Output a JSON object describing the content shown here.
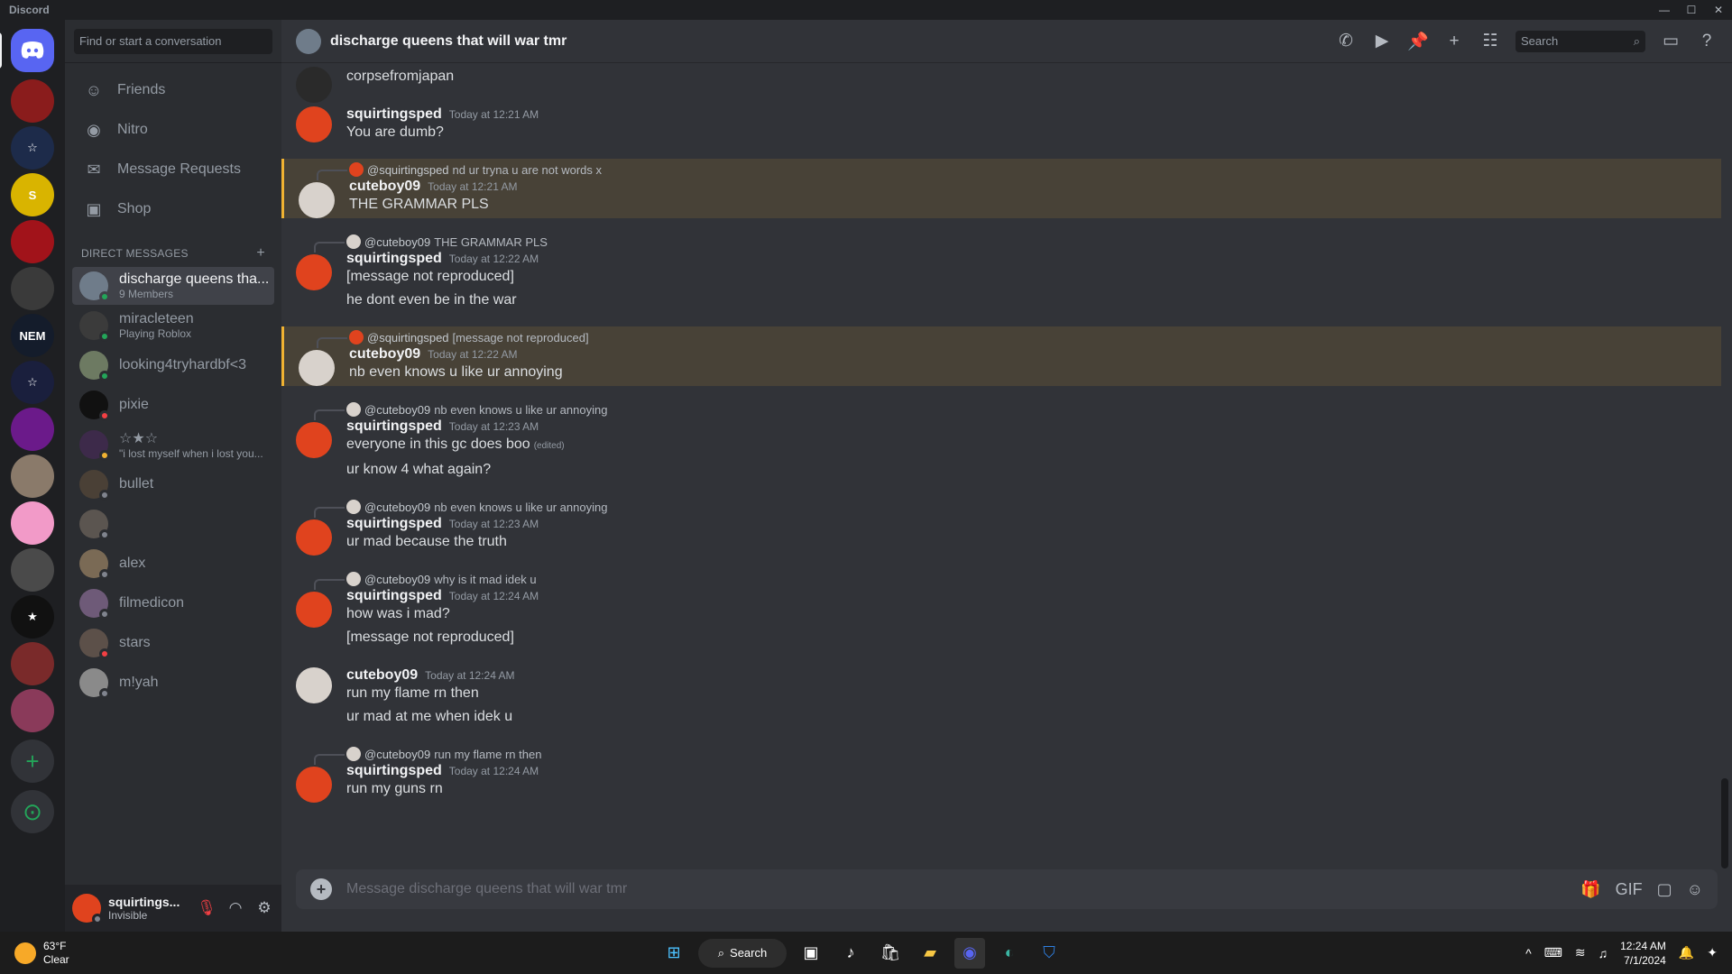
{
  "window": {
    "app_name": "Discord"
  },
  "dm_sidebar": {
    "search_placeholder": "Find or start a conversation",
    "nav": [
      {
        "label": "Friends"
      },
      {
        "label": "Nitro"
      },
      {
        "label": "Message Requests"
      },
      {
        "label": "Shop"
      }
    ],
    "section_title": "Direct Messages",
    "dms": [
      {
        "name": "discharge queens tha...",
        "sub": "9 Members",
        "status": "#23a559",
        "color": "#6f7c8a"
      },
      {
        "name": "miracleteen",
        "sub": "Playing Roblox",
        "status": "#23a559",
        "color": "#3b3b3b"
      },
      {
        "name": "looking4tryhardbf<3",
        "sub": "",
        "status": "#23a559",
        "color": "#6d7a62"
      },
      {
        "name": "pixie",
        "sub": "",
        "status": "#f23f43",
        "color": "#111111"
      },
      {
        "name": "☆★☆",
        "sub": "\"i lost myself when i lost you...",
        "status": "#f0b232",
        "color": "#3d2a4a"
      },
      {
        "name": "bullet",
        "sub": "",
        "status": "#80848e",
        "color": "#4a4036"
      },
      {
        "name": "",
        "sub": "",
        "status": "#80848e",
        "color": "#5b5550"
      },
      {
        "name": "alex",
        "sub": "",
        "status": "#80848e",
        "color": "#7a6a55"
      },
      {
        "name": "filmedicon",
        "sub": "",
        "status": "#80848e",
        "color": "#6e5a78"
      },
      {
        "name": "stars",
        "sub": "",
        "status": "#f23f43",
        "color": "#5c5049"
      },
      {
        "name": "m!yah",
        "sub": "",
        "status": "#80848e",
        "color": "#8a8a8a"
      }
    ]
  },
  "user_panel": {
    "name": "squirtings...",
    "status": "Invisible"
  },
  "channel": {
    "title": "discharge queens that will war tmr",
    "search_placeholder": "Search",
    "composer_placeholder": "Message discharge queens that will war tmr"
  },
  "messages": [
    {
      "author": "",
      "time": "",
      "reply": null,
      "lines": [
        "corpsefromjapan"
      ],
      "hl": false,
      "avatar": "#2a2a2a"
    },
    {
      "author": "squirtingsped",
      "time": "Today at 12:21 AM",
      "reply": null,
      "lines": [
        "You are dumb?"
      ],
      "hl": false,
      "avatar": "#e0431e"
    },
    {
      "author": "cuteboy09",
      "time": "Today at 12:21 AM",
      "reply": {
        "name": "@squirtingsped",
        "text": "nd ur tryna u are not words x",
        "avatar": "#e0431e"
      },
      "lines": [
        "THE GRAMMAR PLS"
      ],
      "hl": true,
      "avatar": "#d8d2cc"
    },
    {
      "author": "squirtingsped",
      "time": "Today at 12:22 AM",
      "reply": {
        "name": "@cuteboy09",
        "text": "THE GRAMMAR PLS",
        "avatar": "#d8d2cc"
      },
      "lines": [
        "[message not reproduced]",
        "he dont even be in the war"
      ],
      "hl": false,
      "avatar": "#e0431e"
    },
    {
      "author": "cuteboy09",
      "time": "Today at 12:22 AM",
      "reply": {
        "name": "@squirtingsped",
        "text": "[message not reproduced]",
        "avatar": "#e0431e"
      },
      "lines": [
        "nb even knows u like ur annoying"
      ],
      "hl": true,
      "avatar": "#d8d2cc"
    },
    {
      "author": "squirtingsped",
      "time": "Today at 12:23 AM",
      "reply": {
        "name": "@cuteboy09",
        "text": "nb even knows u like ur annoying",
        "avatar": "#d8d2cc"
      },
      "lines": [
        "everyone in this gc does boo",
        "ur know 4 what again?"
      ],
      "edited_first": "(edited)",
      "hl": false,
      "avatar": "#e0431e"
    },
    {
      "author": "squirtingsped",
      "time": "Today at 12:23 AM",
      "reply": {
        "name": "@cuteboy09",
        "text": "nb even knows u like ur annoying",
        "avatar": "#d8d2cc"
      },
      "lines": [
        "ur mad because the truth"
      ],
      "hl": false,
      "avatar": "#e0431e"
    },
    {
      "author": "squirtingsped",
      "time": "Today at 12:24 AM",
      "reply": {
        "name": "@cuteboy09",
        "text": "why is it mad idek u",
        "avatar": "#d8d2cc"
      },
      "lines": [
        "how was i mad?",
        "[message not reproduced]"
      ],
      "hl": false,
      "avatar": "#e0431e"
    },
    {
      "author": "cuteboy09",
      "time": "Today at 12:24 AM",
      "reply": null,
      "lines": [
        "run my flame rn then",
        "ur mad at me when idek u"
      ],
      "hl": false,
      "avatar": "#d8d2cc"
    },
    {
      "author": "squirtingsped",
      "time": "Today at 12:24 AM",
      "reply": {
        "name": "@cuteboy09",
        "text": "run my flame rn then",
        "avatar": "#d8d2cc"
      },
      "lines": [
        "run my guns rn"
      ],
      "hl": false,
      "avatar": "#e0431e"
    }
  ],
  "taskbar": {
    "weather_temp": "63°F",
    "weather_desc": "Clear",
    "search_label": "Search",
    "time": "12:24 AM",
    "date": "7/1/2024"
  },
  "guilds": [
    {
      "label": "",
      "color": "#8a1c1c"
    },
    {
      "label": "☆",
      "color": "#1d2b4a"
    },
    {
      "label": "S",
      "color": "#d9b400"
    },
    {
      "label": "",
      "color": "#a1131a"
    },
    {
      "label": "",
      "color": "#3a3a3a"
    },
    {
      "label": "NEM",
      "color": "#141c2b"
    },
    {
      "label": "☆",
      "color": "#1a1f3d"
    },
    {
      "label": "",
      "color": "#6b1a8a"
    },
    {
      "label": "",
      "color": "#8a7a6a"
    },
    {
      "label": "",
      "color": "#f29ac8"
    },
    {
      "label": "",
      "color": "#4a4a4a"
    },
    {
      "label": "★",
      "color": "#111111"
    },
    {
      "label": "",
      "color": "#7a2a2a"
    },
    {
      "label": "",
      "color": "#8a3a5a"
    }
  ]
}
